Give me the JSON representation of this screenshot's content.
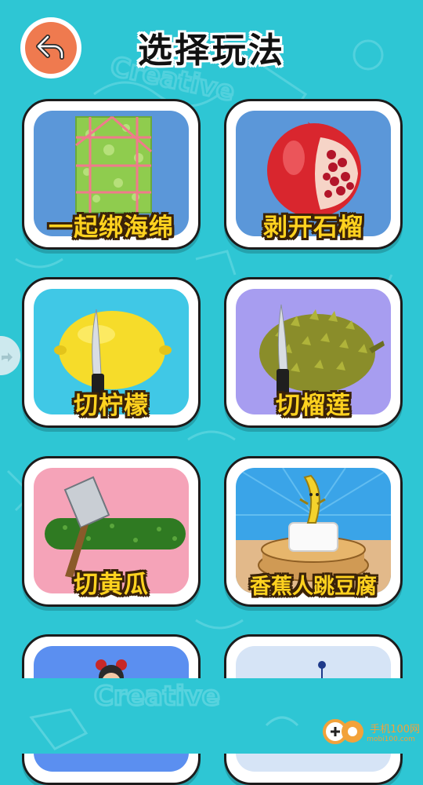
{
  "header": {
    "title": "选择玩法",
    "back_icon": "back-arrow-icon"
  },
  "games": [
    {
      "label": "一起绑海绵",
      "icon": "sponge-icon",
      "bg": "#5b97d9"
    },
    {
      "label": "剥开石榴",
      "icon": "pomegranate-icon",
      "bg": "#5b97d9"
    },
    {
      "label": "切柠檬",
      "icon": "lemon-knife-icon",
      "bg": "#40c8e6"
    },
    {
      "label": "切榴莲",
      "icon": "durian-knife-icon",
      "bg": "#a79df0"
    },
    {
      "label": "切黄瓜",
      "icon": "cucumber-cleaver-icon",
      "bg": "#f5a3b8"
    },
    {
      "label": "香蕉人跳豆腐",
      "icon": "banana-tofu-icon",
      "bg": "#3aa4e8"
    },
    {
      "label": "",
      "icon": "girl-avatar-icon",
      "bg": "#5b8ff0"
    },
    {
      "label": "",
      "icon": "dots-icon",
      "bg": "#d6e4f6"
    }
  ],
  "watermark": {
    "label": "手机100网",
    "sub": "mobi100.com"
  },
  "colors": {
    "background": "#2ec6d4",
    "back_button": "#ef7a4f",
    "label_fill": "#ffd21f",
    "label_stroke": "#3a2208"
  }
}
